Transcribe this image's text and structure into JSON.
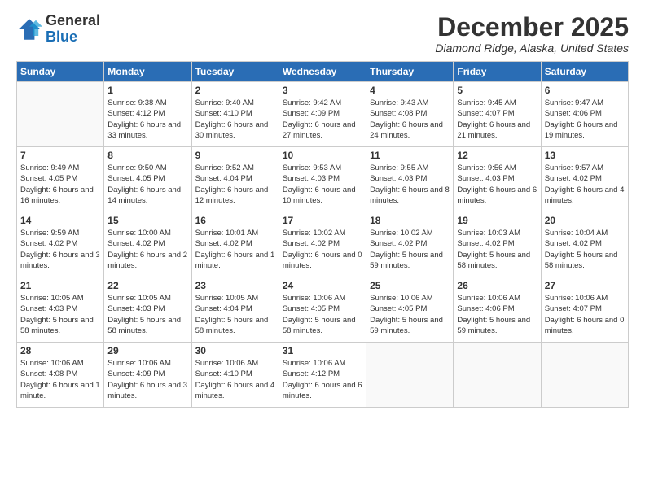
{
  "logo": {
    "general": "General",
    "blue": "Blue"
  },
  "header": {
    "month": "December 2025",
    "location": "Diamond Ridge, Alaska, United States"
  },
  "weekdays": [
    "Sunday",
    "Monday",
    "Tuesday",
    "Wednesday",
    "Thursday",
    "Friday",
    "Saturday"
  ],
  "weeks": [
    [
      {
        "day": "",
        "sunrise": "",
        "sunset": "",
        "daylight": ""
      },
      {
        "day": "1",
        "sunrise": "Sunrise: 9:38 AM",
        "sunset": "Sunset: 4:12 PM",
        "daylight": "Daylight: 6 hours and 33 minutes."
      },
      {
        "day": "2",
        "sunrise": "Sunrise: 9:40 AM",
        "sunset": "Sunset: 4:10 PM",
        "daylight": "Daylight: 6 hours and 30 minutes."
      },
      {
        "day": "3",
        "sunrise": "Sunrise: 9:42 AM",
        "sunset": "Sunset: 4:09 PM",
        "daylight": "Daylight: 6 hours and 27 minutes."
      },
      {
        "day": "4",
        "sunrise": "Sunrise: 9:43 AM",
        "sunset": "Sunset: 4:08 PM",
        "daylight": "Daylight: 6 hours and 24 minutes."
      },
      {
        "day": "5",
        "sunrise": "Sunrise: 9:45 AM",
        "sunset": "Sunset: 4:07 PM",
        "daylight": "Daylight: 6 hours and 21 minutes."
      },
      {
        "day": "6",
        "sunrise": "Sunrise: 9:47 AM",
        "sunset": "Sunset: 4:06 PM",
        "daylight": "Daylight: 6 hours and 19 minutes."
      }
    ],
    [
      {
        "day": "7",
        "sunrise": "Sunrise: 9:49 AM",
        "sunset": "Sunset: 4:05 PM",
        "daylight": "Daylight: 6 hours and 16 minutes."
      },
      {
        "day": "8",
        "sunrise": "Sunrise: 9:50 AM",
        "sunset": "Sunset: 4:05 PM",
        "daylight": "Daylight: 6 hours and 14 minutes."
      },
      {
        "day": "9",
        "sunrise": "Sunrise: 9:52 AM",
        "sunset": "Sunset: 4:04 PM",
        "daylight": "Daylight: 6 hours and 12 minutes."
      },
      {
        "day": "10",
        "sunrise": "Sunrise: 9:53 AM",
        "sunset": "Sunset: 4:03 PM",
        "daylight": "Daylight: 6 hours and 10 minutes."
      },
      {
        "day": "11",
        "sunrise": "Sunrise: 9:55 AM",
        "sunset": "Sunset: 4:03 PM",
        "daylight": "Daylight: 6 hours and 8 minutes."
      },
      {
        "day": "12",
        "sunrise": "Sunrise: 9:56 AM",
        "sunset": "Sunset: 4:03 PM",
        "daylight": "Daylight: 6 hours and 6 minutes."
      },
      {
        "day": "13",
        "sunrise": "Sunrise: 9:57 AM",
        "sunset": "Sunset: 4:02 PM",
        "daylight": "Daylight: 6 hours and 4 minutes."
      }
    ],
    [
      {
        "day": "14",
        "sunrise": "Sunrise: 9:59 AM",
        "sunset": "Sunset: 4:02 PM",
        "daylight": "Daylight: 6 hours and 3 minutes."
      },
      {
        "day": "15",
        "sunrise": "Sunrise: 10:00 AM",
        "sunset": "Sunset: 4:02 PM",
        "daylight": "Daylight: 6 hours and 2 minutes."
      },
      {
        "day": "16",
        "sunrise": "Sunrise: 10:01 AM",
        "sunset": "Sunset: 4:02 PM",
        "daylight": "Daylight: 6 hours and 1 minute."
      },
      {
        "day": "17",
        "sunrise": "Sunrise: 10:02 AM",
        "sunset": "Sunset: 4:02 PM",
        "daylight": "Daylight: 6 hours and 0 minutes."
      },
      {
        "day": "18",
        "sunrise": "Sunrise: 10:02 AM",
        "sunset": "Sunset: 4:02 PM",
        "daylight": "Daylight: 5 hours and 59 minutes."
      },
      {
        "day": "19",
        "sunrise": "Sunrise: 10:03 AM",
        "sunset": "Sunset: 4:02 PM",
        "daylight": "Daylight: 5 hours and 58 minutes."
      },
      {
        "day": "20",
        "sunrise": "Sunrise: 10:04 AM",
        "sunset": "Sunset: 4:02 PM",
        "daylight": "Daylight: 5 hours and 58 minutes."
      }
    ],
    [
      {
        "day": "21",
        "sunrise": "Sunrise: 10:05 AM",
        "sunset": "Sunset: 4:03 PM",
        "daylight": "Daylight: 5 hours and 58 minutes."
      },
      {
        "day": "22",
        "sunrise": "Sunrise: 10:05 AM",
        "sunset": "Sunset: 4:03 PM",
        "daylight": "Daylight: 5 hours and 58 minutes."
      },
      {
        "day": "23",
        "sunrise": "Sunrise: 10:05 AM",
        "sunset": "Sunset: 4:04 PM",
        "daylight": "Daylight: 5 hours and 58 minutes."
      },
      {
        "day": "24",
        "sunrise": "Sunrise: 10:06 AM",
        "sunset": "Sunset: 4:05 PM",
        "daylight": "Daylight: 5 hours and 58 minutes."
      },
      {
        "day": "25",
        "sunrise": "Sunrise: 10:06 AM",
        "sunset": "Sunset: 4:05 PM",
        "daylight": "Daylight: 5 hours and 59 minutes."
      },
      {
        "day": "26",
        "sunrise": "Sunrise: 10:06 AM",
        "sunset": "Sunset: 4:06 PM",
        "daylight": "Daylight: 5 hours and 59 minutes."
      },
      {
        "day": "27",
        "sunrise": "Sunrise: 10:06 AM",
        "sunset": "Sunset: 4:07 PM",
        "daylight": "Daylight: 6 hours and 0 minutes."
      }
    ],
    [
      {
        "day": "28",
        "sunrise": "Sunrise: 10:06 AM",
        "sunset": "Sunset: 4:08 PM",
        "daylight": "Daylight: 6 hours and 1 minute."
      },
      {
        "day": "29",
        "sunrise": "Sunrise: 10:06 AM",
        "sunset": "Sunset: 4:09 PM",
        "daylight": "Daylight: 6 hours and 3 minutes."
      },
      {
        "day": "30",
        "sunrise": "Sunrise: 10:06 AM",
        "sunset": "Sunset: 4:10 PM",
        "daylight": "Daylight: 6 hours and 4 minutes."
      },
      {
        "day": "31",
        "sunrise": "Sunrise: 10:06 AM",
        "sunset": "Sunset: 4:12 PM",
        "daylight": "Daylight: 6 hours and 6 minutes."
      },
      {
        "day": "",
        "sunrise": "",
        "sunset": "",
        "daylight": ""
      },
      {
        "day": "",
        "sunrise": "",
        "sunset": "",
        "daylight": ""
      },
      {
        "day": "",
        "sunrise": "",
        "sunset": "",
        "daylight": ""
      }
    ]
  ]
}
